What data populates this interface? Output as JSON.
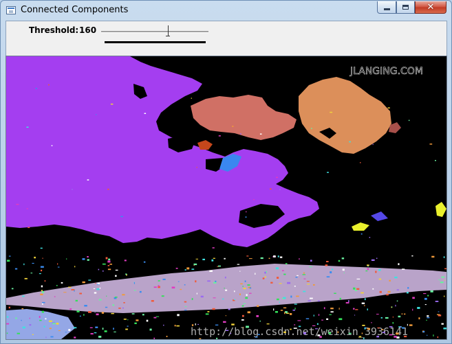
{
  "window": {
    "title": "Connected Components",
    "icon": "app-window-icon",
    "controls": [
      "minimize-icon",
      "maximize-icon",
      "close-icon"
    ]
  },
  "toolbar": {
    "threshold_label": "Threshold:",
    "threshold_value": "160",
    "slider": {
      "min": 0,
      "max": 255,
      "value": 160
    }
  },
  "image": {
    "description_watermark": "http://blog.csdn.net/weixin_3936141",
    "corner_watermark": "JLANGING.COM"
  },
  "colors": {
    "sky_component": "#a43ef0",
    "cloud_salmon": "#d07065",
    "cloud_orange": "#dc8f5a",
    "foreground_lilac": "#b9a3c9",
    "blob_blue": "#3a87f0",
    "blob_rust": "#c5471b",
    "blob_yellow": "#e9f02c",
    "blob_periwinkle": "#94a7e6"
  }
}
